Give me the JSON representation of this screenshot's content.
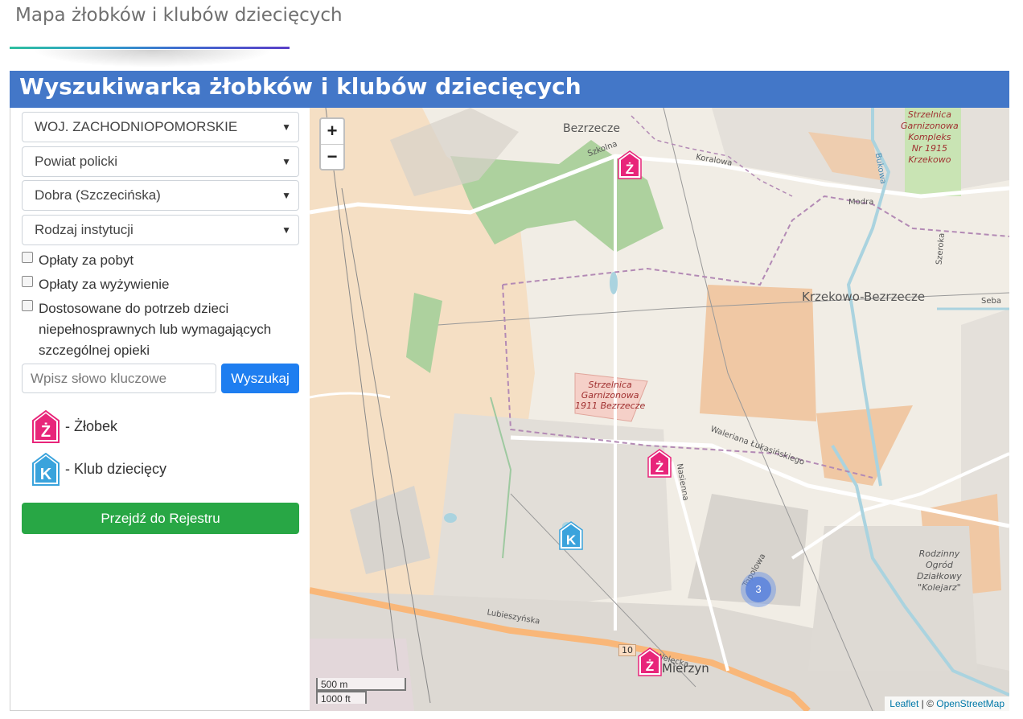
{
  "page": {
    "title": "Mapa żłobków i klubów dziecięcych"
  },
  "header": {
    "title": "Wyszukiwarka żłobków i klubów dziecięcych"
  },
  "filters": {
    "voivodeship": "WOJ. ZACHODNIOPOMORSKIE",
    "county": "Powiat policki",
    "municipality": "Dobra (Szczecińska)",
    "institution_type": "Rodzaj instytucji"
  },
  "checkboxes": {
    "stay_fees": "Opłaty za pobyt",
    "food_fees": "Opłaty za wyżywienie",
    "disability_adapted": "Dostosowane do potrzeb dzieci niepełnosprawnych lub wymagających szczególnej opieki"
  },
  "search": {
    "placeholder": "Wpisz słowo kluczowe",
    "button": "Wyszukaj"
  },
  "legend": {
    "nursery_letter": "Ż",
    "nursery_label": "- Żłobek",
    "club_letter": "K",
    "club_label": "- Klub dziecięcy"
  },
  "registry_button": "Przejdź do Rejestru",
  "map": {
    "zoom_in": "+",
    "zoom_out": "−",
    "scale_metric": "500 m",
    "scale_imperial": "1000 ft",
    "attribution_leaflet": "Leaflet",
    "attribution_sep": " | © ",
    "attribution_osm": "OpenStreetMap",
    "cluster_count": "3",
    "marker_nursery_letter": "Ż",
    "marker_club_letter": "K",
    "places": {
      "bezrzecze": "Bezrzecze",
      "krzekowo_bezrzecze": "Krzekowo-Bezrzecze",
      "mierzyn": "Mierzyn",
      "strzelnica_bezrzecze": [
        "Strzelnica",
        "Garnizonowa",
        "1911 Bezrzecze"
      ],
      "strzelnica_krzekowo": [
        "Strzelnica",
        "Garnizonowa",
        "Kompleks",
        "Nr 1915",
        "Krzekowo"
      ],
      "ogrod": [
        "Rodzinny",
        "Ogród",
        "Działkowy",
        "\"Kolejarz\""
      ]
    },
    "streets": {
      "szkolna": "Szkolna",
      "koralowa": "Koralowa",
      "modra": "Modra",
      "bukowa": "Bukowa",
      "szeroka": "Szeroka",
      "walerian": "Waleriana Łukasińskiego",
      "nasienna": "Nasienna",
      "lubieszynska": "Lubieszyńska",
      "topolowa": "Topolowa",
      "welecka": "Welecka",
      "road_number": "10",
      "seba": "Seba"
    }
  },
  "colors": {
    "header_bg": "#4377c8",
    "search_btn": "#1e7ef0",
    "registry_btn": "#28a745",
    "nursery_pink": "#e8257a",
    "club_blue": "#3aa3dc"
  }
}
